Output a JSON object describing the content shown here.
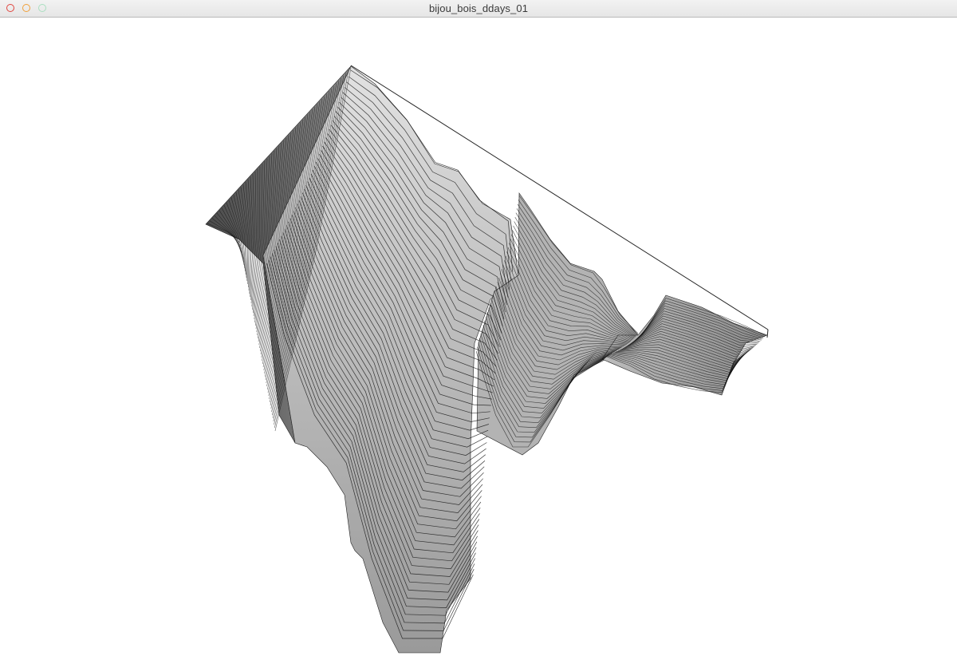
{
  "window": {
    "title": "bijou_bois_ddays_01",
    "controls": {
      "close_color": "#e0443e",
      "minimize_color": "#f0a03a",
      "zoom_color": "#a9dfc0"
    }
  },
  "canvas": {
    "background": "#ffffff",
    "surface_fill": "#a6a6a6",
    "contour_color": "#111111",
    "render_type": "wireframe surface"
  }
}
